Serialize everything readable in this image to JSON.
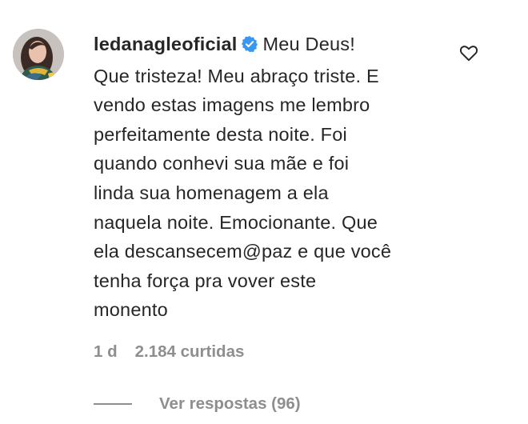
{
  "comment": {
    "username": "ledanagleoficial",
    "verified_icon": "verified-badge-icon",
    "text_lines": [
      "Meu Deus!",
      "Que tristeza! Meu abraço triste. E",
      "vendo estas imagens me lembro",
      "perfeitamente desta noite. Foi",
      "quando conhevi sua mãe e foi",
      "linda sua homenagem a ela",
      "naquela noite. Emocionante. Que",
      "ela descansecem@paz e que você",
      "tenha força pra vover este",
      "monento"
    ],
    "time": "1 d",
    "likes": "2.184 curtidas",
    "view_replies": "Ver respostas (96)",
    "like_icon": "heart-outline-icon"
  },
  "colors": {
    "text": "#262626",
    "secondary": "#8e8e8e",
    "verified": "#3897f0"
  }
}
